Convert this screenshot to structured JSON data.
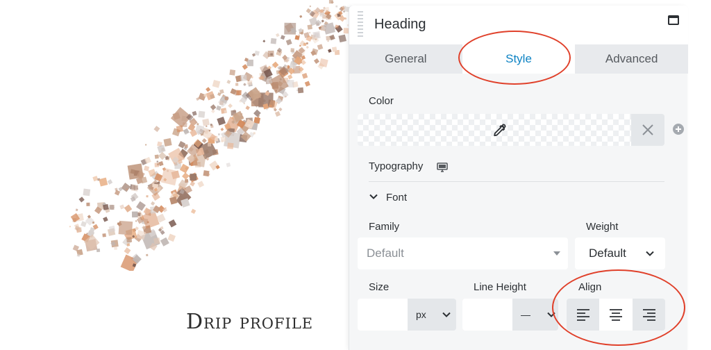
{
  "canvas": {
    "caption": "Drip profile"
  },
  "panel": {
    "title": "Heading",
    "tabs": [
      {
        "label": "General",
        "active": false
      },
      {
        "label": "Style",
        "active": true
      },
      {
        "label": "Advanced",
        "active": false
      }
    ],
    "color": {
      "label": "Color",
      "value": ""
    },
    "typography": {
      "label": "Typography",
      "font_section": "Font",
      "family": {
        "label": "Family",
        "value": "Default"
      },
      "weight": {
        "label": "Weight",
        "value": "Default"
      },
      "size": {
        "label": "Size",
        "value": "",
        "unit": "px"
      },
      "line_height": {
        "label": "Line Height",
        "value": "",
        "unit": "—"
      },
      "align": {
        "label": "Align",
        "options": [
          "left",
          "center",
          "right"
        ],
        "selected": "center"
      }
    }
  },
  "colors": {
    "accent": "#0e83c4",
    "annotation": "#e0402a",
    "panel_bg": "#f5f6f7"
  },
  "icons": [
    "drag-handle-icon",
    "window-icon",
    "eyedropper-icon",
    "close-icon",
    "plus-icon",
    "monitor-icon",
    "chevron-down-icon",
    "caret-down-icon",
    "align-left-icon",
    "align-center-icon",
    "align-right-icon"
  ]
}
